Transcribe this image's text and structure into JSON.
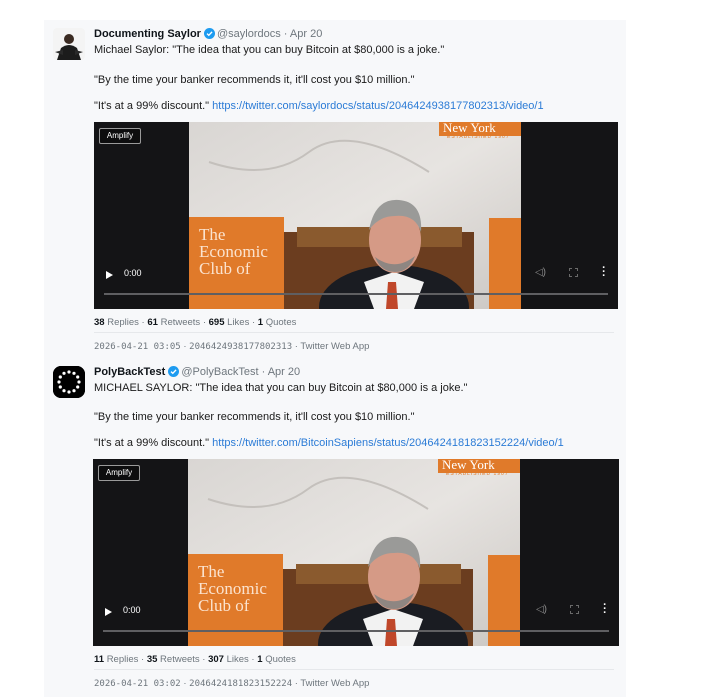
{
  "tweets": [
    {
      "author": "Documenting Saylor",
      "handle": "@saylordocs",
      "separator": "·",
      "date": "Apr 20",
      "line1": "Michael Saylor: \"The idea that you can buy Bitcoin at $80,000 is a joke.\"",
      "line2": "\"By the time your banker recommends it, it'll cost you $10 million.\"",
      "line3_text": "\"It's at a 99% discount.\"",
      "line3_link": "https://twitter.com/saylordocs/status/2046424938177802313/video/1",
      "video": {
        "amplify": "Amplify",
        "time": "0:00",
        "progress": 0
      },
      "stats": {
        "replies_count": "38",
        "replies_label": "Replies",
        "retweets_count": "61",
        "retweets_label": "Retweets",
        "likes_count": "695",
        "likes_label": "Likes",
        "quotes_count": "1",
        "quotes_label": "Quotes"
      },
      "meta": {
        "timestamp": "2026-04-21 03:05",
        "id": "2046424938177802313",
        "source": "Twitter Web App"
      }
    },
    {
      "author": "PolyBackTest",
      "handle": "@PolyBackTest",
      "separator": "·",
      "date": "Apr 20",
      "line1": "MICHAEL SAYLOR: \"The idea that you can buy Bitcoin at $80,000 is a joke.\"",
      "line2": "\"By the time your banker recommends it, it'll cost you $10 million.\"",
      "line3_text": "\"It's at a 99% discount.\"",
      "line3_link": "https://twitter.com/BitcoinSapiens/status/2046424181823152224/video/1",
      "video": {
        "amplify": "Amplify",
        "time": "0:00",
        "progress": 0
      },
      "stats": {
        "replies_count": "11",
        "replies_label": "Replies",
        "retweets_count": "35",
        "retweets_label": "Retweets",
        "likes_count": "307",
        "likes_label": "Likes",
        "quotes_count": "1",
        "quotes_label": "Quotes"
      },
      "meta": {
        "timestamp": "2026-04-21 03:02",
        "id": "2046424181823152224",
        "source": "Twitter Web App"
      }
    }
  ],
  "video_scene": {
    "banner": "New York",
    "banner_sub": "ESTABLISHED 1907",
    "sign_line1": "The",
    "sign_line2": "Economic",
    "sign_line3": "Club of"
  },
  "colors": {
    "link": "#2b7bd6",
    "verified": "#1d9bf0",
    "sign": "#e07a2a"
  }
}
